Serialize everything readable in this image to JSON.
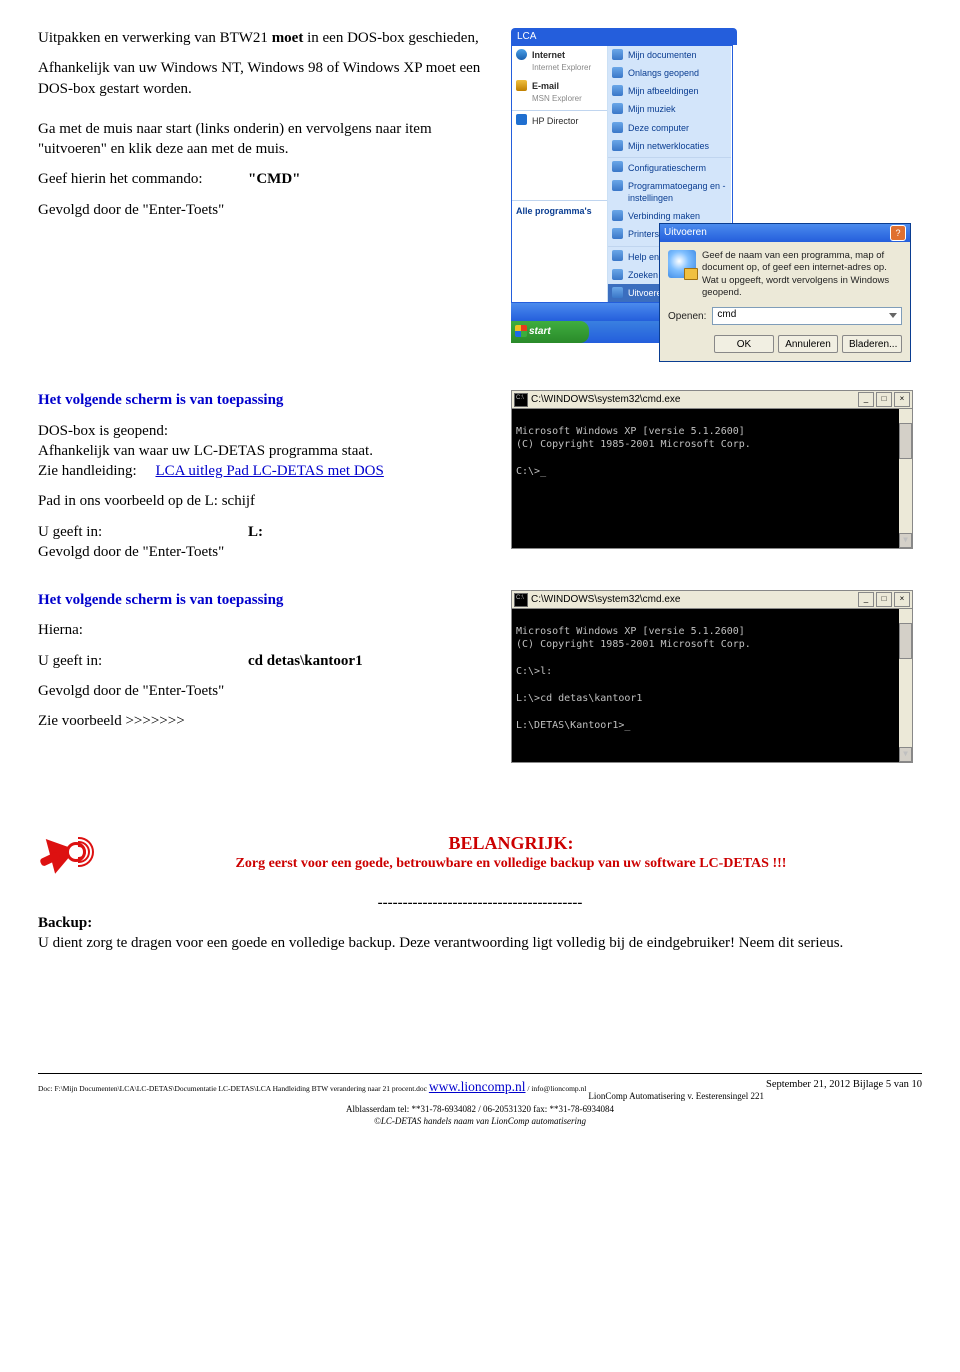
{
  "intro": {
    "line1_a": "Uitpakken en verwerking van BTW21 ",
    "line1_b": "moet",
    "line1_c": " in een DOS-box geschieden,",
    "line2": "Afhankelijk van uw Windows NT, Windows 98 of Windows XP moet een DOS-box gestart worden.",
    "line3": "Ga met de muis naar start (links onderin) en vervolgens naar item \"uitvoeren\" en klik deze aan met de muis.",
    "cmd_label": "Geef hierin het commando:",
    "cmd_value": "\"CMD\"",
    "line5": "Gevolgd door de \"Enter-Toets\""
  },
  "xp": {
    "lca_title": "LCA",
    "left_items": [
      "Internet",
      "E-mail",
      "HP Director"
    ],
    "left_sub": [
      "Internet Explorer",
      "MSN Explorer"
    ],
    "right_items": [
      "Mijn documenten",
      "Onlangs geopend",
      "Mijn afbeeldingen",
      "Mijn muziek",
      "Deze computer",
      "Mijn netwerklocaties",
      "Configuratiescherm",
      "Programmatoegang en -instellingen",
      "Verbinding maken",
      "Printers en faxapparaten",
      "Help en ondersteuning",
      "Zoeken",
      "Uitvoeren..."
    ],
    "all_programs": "Alle programma's",
    "start": "start",
    "uitvoeren": {
      "title": "Uitvoeren",
      "help_text": "Geef de naam van een programma, map of document op, of geef een internet-adres op. Wat u opgeeft, wordt vervolgens in Windows geopend.",
      "open_label": "Openen:",
      "open_value": "cmd",
      "btn_ok": "OK",
      "btn_cancel": "Annuleren",
      "btn_browse": "Bladeren..."
    }
  },
  "section2": {
    "heading": "Het volgende scherm is van toepassing",
    "p1": "DOS-box is geopend:",
    "p2": "Afhankelijk van waar uw LC-DETAS programma staat.",
    "p3a": "Zie handleiding:",
    "p3b": "LCA uitleg Pad LC-DETAS met DOS",
    "p4": "Pad in ons voorbeeld op de L: schijf",
    "cmd_label": "U geeft in:",
    "cmd_value": "L:",
    "p6": "Gevolgd door de \"Enter-Toets\""
  },
  "cmd1": {
    "title": "C:\\WINDOWS\\system32\\cmd.exe",
    "lines": [
      "Microsoft Windows XP [versie 5.1.2600]",
      "(C) Copyright 1985-2001 Microsoft Corp.",
      "",
      "C:\\>_"
    ]
  },
  "section3": {
    "heading": "Het volgende scherm is van toepassing",
    "p1": "Hierna:",
    "cmd_label": "U geeft in:",
    "cmd_value": "cd detas\\kantoor1",
    "p3": "Gevolgd door de \"Enter-Toets\"",
    "p4": "Zie voorbeeld >>>>>>>"
  },
  "cmd2": {
    "title": "C:\\WINDOWS\\system32\\cmd.exe",
    "lines": [
      "Microsoft Windows XP [versie 5.1.2600]",
      "(C) Copyright 1985-2001 Microsoft Corp.",
      "",
      "C:\\>l:",
      "",
      "L:\\>cd detas\\kantoor1",
      "",
      "L:\\DETAS\\Kantoor1>_"
    ]
  },
  "important": {
    "title": "BELANGRIJK:",
    "sub": "Zorg eerst voor een goede, betrouwbare en volledige backup van uw software LC-DETAS !!!",
    "dashes": "-----------------------------------------",
    "backup_label": "Backup:",
    "backup_text": "U dient zorg te dragen voor een goede en volledige backup. Deze verantwoording ligt volledig bij de eindgebruiker! Neem dit serieus."
  },
  "footer": {
    "doc_prefix": "Doc: ",
    "doc_path": "F:\\Mijn Documenten\\LCA\\LC-DETAS\\Documentatie LC-DETAS\\LCA Handleiding BTW verandering naar 21 procent.doc ",
    "www": "www.lioncomp.nl",
    "email": " / info@lioncomp.nl",
    "date_page": "September 21, 2012    Bijlage 5 van 10",
    "line2": "LionComp Automatisering  v.  Eesterensingel  221 Alblasserdam  tel: **31-78-6934082 / 06-20531320 fax: **31-78-6934084",
    "line3": "©LC-DETAS handels naam van LionComp automatisering"
  }
}
